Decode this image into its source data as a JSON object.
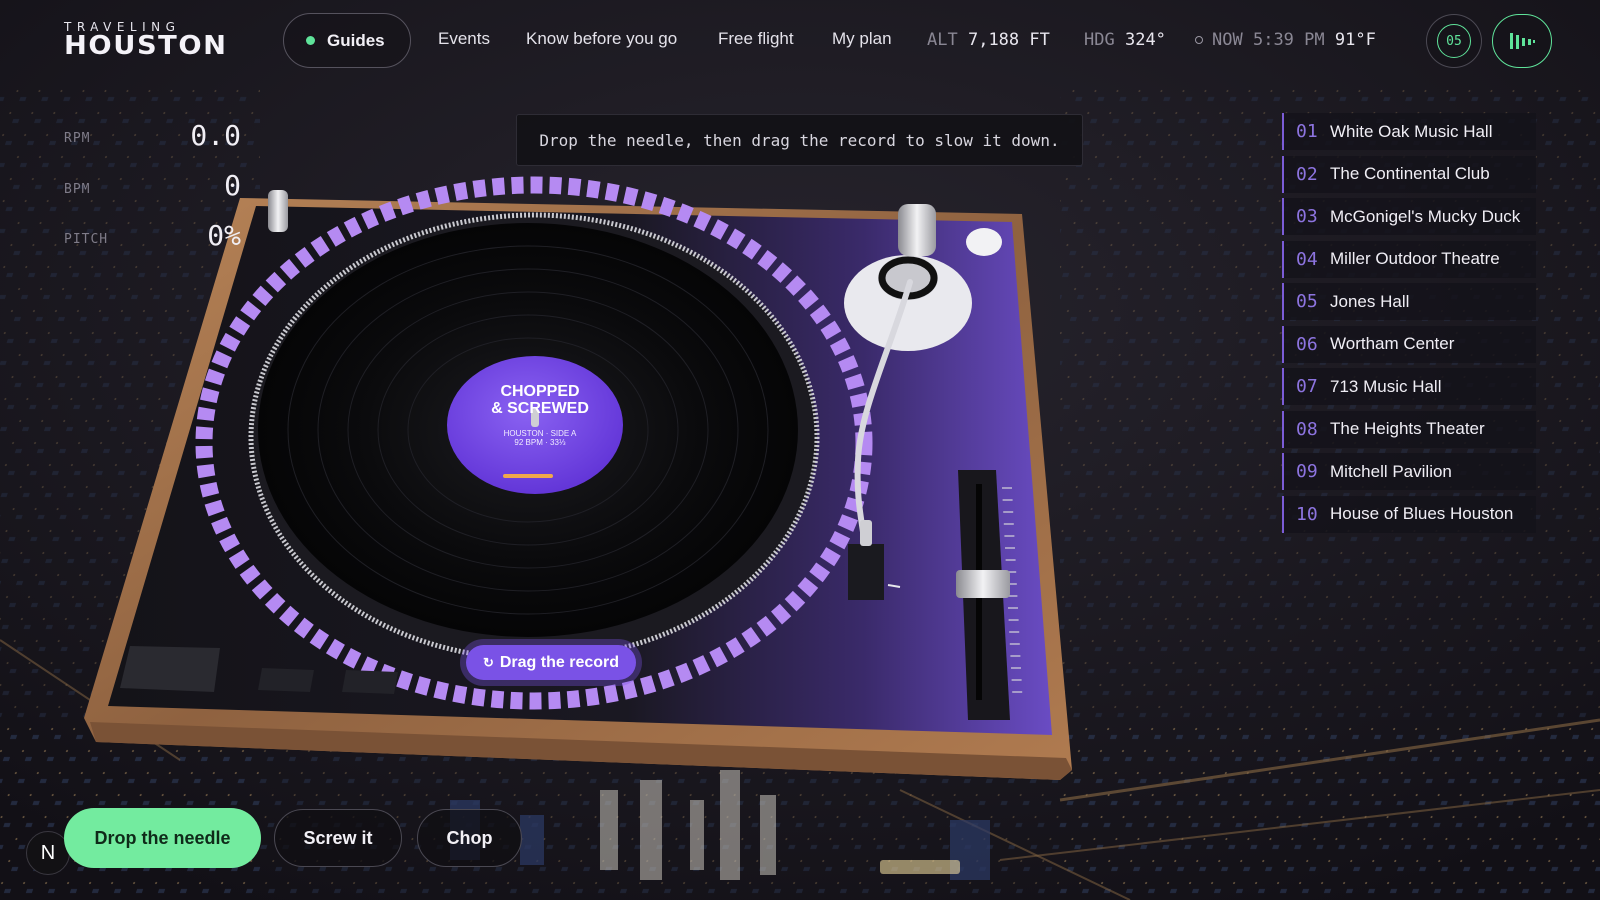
{
  "brand": {
    "top": "TRAVELING",
    "main": "HOUSTON"
  },
  "nav": {
    "guides": "Guides",
    "links": [
      "Events",
      "Know before you go",
      "Free flight",
      "My plan"
    ]
  },
  "telemetry": {
    "alt_label": "ALT",
    "alt_value": "7,188 FT",
    "hdg_label": "HDG",
    "hdg_value": "324°",
    "now_label": "NOW",
    "now_value": "5:39 PM",
    "temp": "91°F"
  },
  "counter": "05",
  "stats": [
    {
      "label": "RPM",
      "value": "0.0"
    },
    {
      "label": "BPM",
      "value": "0"
    },
    {
      "label": "PITCH",
      "value": "0%"
    }
  ],
  "hint": "Drop the needle, then drag the record to slow it down.",
  "record_label": {
    "title_line1": "CHOPPED",
    "title_line2": "& SCREWED",
    "sub_line1": "HOUSTON · SIDE A",
    "sub_line2": "92 BPM · 33⅓"
  },
  "drag_button": "Drag the record",
  "venues": [
    {
      "num": "01",
      "name": "White Oak Music Hall"
    },
    {
      "num": "02",
      "name": "The Continental Club"
    },
    {
      "num": "03",
      "name": "McGonigel's Mucky Duck"
    },
    {
      "num": "04",
      "name": "Miller Outdoor Theatre"
    },
    {
      "num": "05",
      "name": "Jones Hall"
    },
    {
      "num": "06",
      "name": "Wortham Center"
    },
    {
      "num": "07",
      "name": "713 Music Hall"
    },
    {
      "num": "08",
      "name": "The Heights Theater"
    },
    {
      "num": "09",
      "name": "Mitchell Pavilion"
    },
    {
      "num": "10",
      "name": "House of Blues Houston"
    }
  ],
  "actions": {
    "badge": "N",
    "primary": "Drop the needle",
    "screw": "Screw it",
    "chop": "Chop"
  },
  "colors": {
    "accent_green": "#73eb9f",
    "accent_purple": "#7a52e6",
    "wood": "#a0704a"
  }
}
